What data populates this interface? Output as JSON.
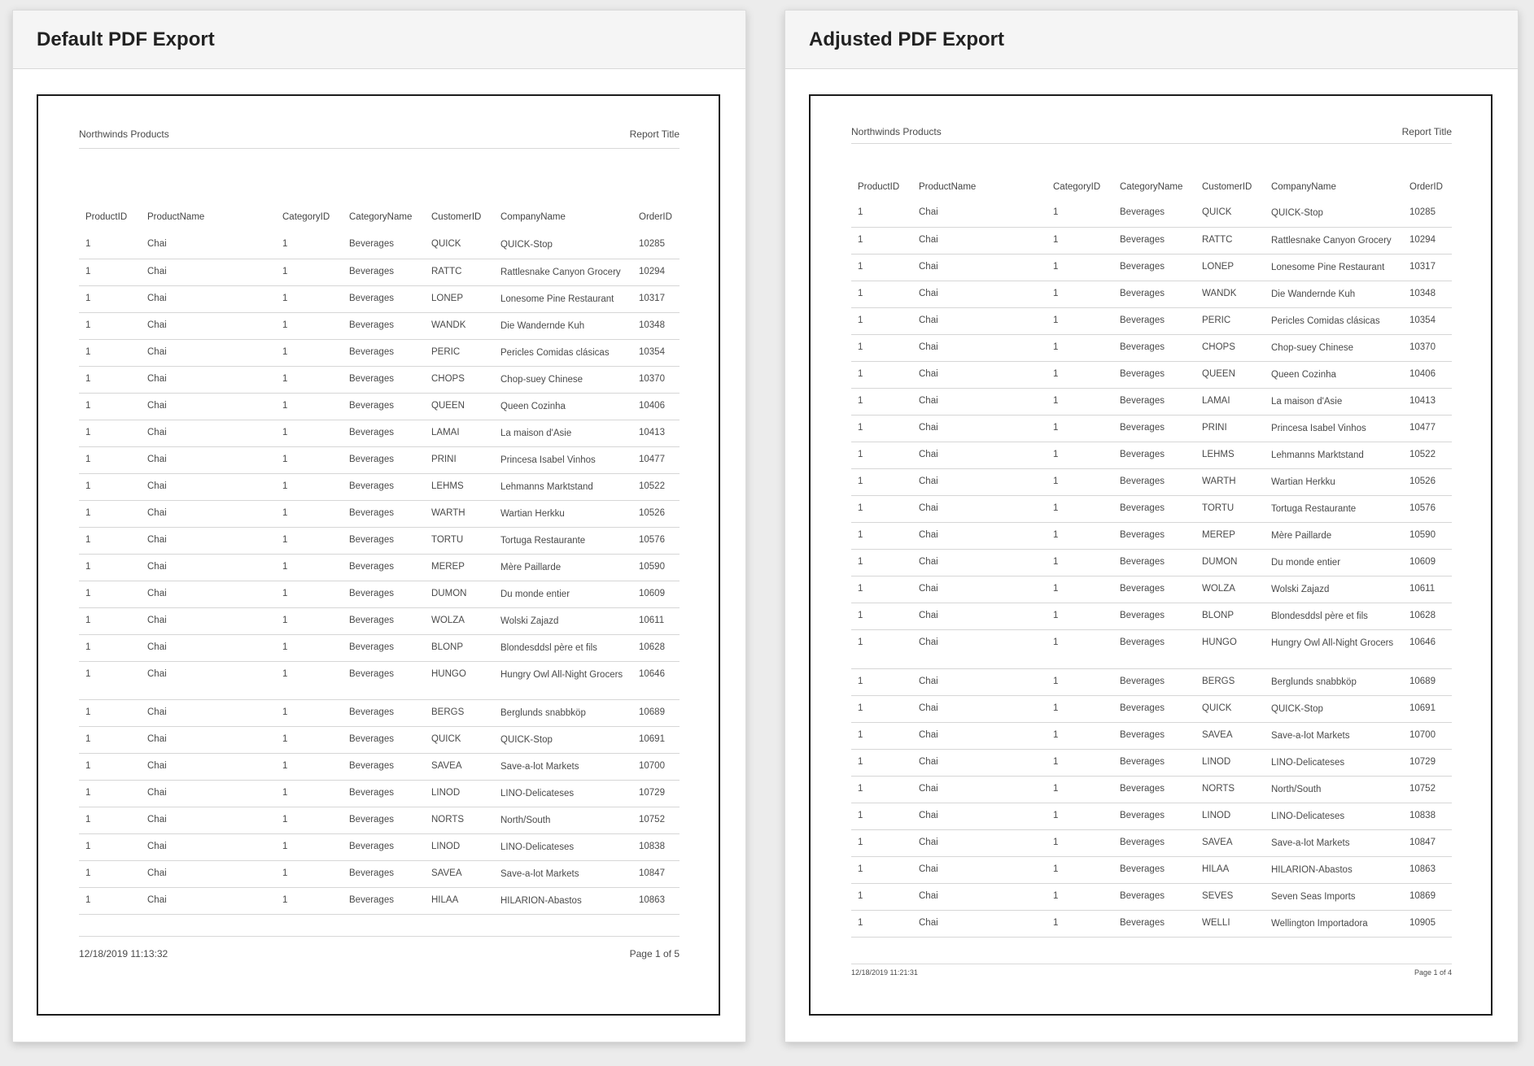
{
  "panels": [
    {
      "title": "Default PDF Export",
      "doc": {
        "left_header": "Northwinds Products",
        "right_header": "Report Title",
        "columns": [
          "ProductID",
          "ProductName",
          "CategoryID",
          "CategoryName",
          "CustomerID",
          "CompanyName",
          "OrderID"
        ],
        "rows": [
          [
            "1",
            "Chai",
            "1",
            "Beverages",
            "QUICK",
            "QUICK-Stop",
            "10285"
          ],
          [
            "1",
            "Chai",
            "1",
            "Beverages",
            "RATTC",
            "Rattlesnake Canyon Grocery",
            "10294"
          ],
          [
            "1",
            "Chai",
            "1",
            "Beverages",
            "LONEP",
            "Lonesome Pine Restaurant",
            "10317"
          ],
          [
            "1",
            "Chai",
            "1",
            "Beverages",
            "WANDK",
            "Die Wandernde Kuh",
            "10348"
          ],
          [
            "1",
            "Chai",
            "1",
            "Beverages",
            "PERIC",
            "Pericles Comidas clásicas",
            "10354"
          ],
          [
            "1",
            "Chai",
            "1",
            "Beverages",
            "CHOPS",
            "Chop-suey Chinese",
            "10370"
          ],
          [
            "1",
            "Chai",
            "1",
            "Beverages",
            "QUEEN",
            "Queen Cozinha",
            "10406"
          ],
          [
            "1",
            "Chai",
            "1",
            "Beverages",
            "LAMAI",
            "La maison d'Asie",
            "10413"
          ],
          [
            "1",
            "Chai",
            "1",
            "Beverages",
            "PRINI",
            "Princesa Isabel Vinhos",
            "10477"
          ],
          [
            "1",
            "Chai",
            "1",
            "Beverages",
            "LEHMS",
            "Lehmanns Marktstand",
            "10522"
          ],
          [
            "1",
            "Chai",
            "1",
            "Beverages",
            "WARTH",
            "Wartian Herkku",
            "10526"
          ],
          [
            "1",
            "Chai",
            "1",
            "Beverages",
            "TORTU",
            "Tortuga Restaurante",
            "10576"
          ],
          [
            "1",
            "Chai",
            "1",
            "Beverages",
            "MEREP",
            "Mère Paillarde",
            "10590"
          ],
          [
            "1",
            "Chai",
            "1",
            "Beverages",
            "DUMON",
            "Du monde entier",
            "10609"
          ],
          [
            "1",
            "Chai",
            "1",
            "Beverages",
            "WOLZA",
            "Wolski Zajazd",
            "10611"
          ],
          [
            "1",
            "Chai",
            "1",
            "Beverages",
            "BLONP",
            "Blondesddsl père et fils",
            "10628"
          ],
          [
            "1",
            "Chai",
            "1",
            "Beverages",
            "HUNGO",
            "Hungry Owl All-Night Grocers",
            "10646"
          ],
          [
            "1",
            "Chai",
            "1",
            "Beverages",
            "BERGS",
            "Berglunds snabbköp",
            "10689"
          ],
          [
            "1",
            "Chai",
            "1",
            "Beverages",
            "QUICK",
            "QUICK-Stop",
            "10691"
          ],
          [
            "1",
            "Chai",
            "1",
            "Beverages",
            "SAVEA",
            "Save-a-lot Markets",
            "10700"
          ],
          [
            "1",
            "Chai",
            "1",
            "Beverages",
            "LINOD",
            "LINO-Delicateses",
            "10729"
          ],
          [
            "1",
            "Chai",
            "1",
            "Beverages",
            "NORTS",
            "North/South",
            "10752"
          ],
          [
            "1",
            "Chai",
            "1",
            "Beverages",
            "LINOD",
            "LINO-Delicateses",
            "10838"
          ],
          [
            "1",
            "Chai",
            "1",
            "Beverages",
            "SAVEA",
            "Save-a-lot Markets",
            "10847"
          ],
          [
            "1",
            "Chai",
            "1",
            "Beverages",
            "HILAA",
            "HILARION-Abastos",
            "10863"
          ]
        ],
        "footer_left": "12/18/2019 11:13:32",
        "footer_right": "Page 1 of 5"
      }
    },
    {
      "title": "Adjusted PDF Export",
      "doc": {
        "left_header": "Northwinds Products",
        "right_header": "Report Title",
        "columns": [
          "ProductID",
          "ProductName",
          "CategoryID",
          "CategoryName",
          "CustomerID",
          "CompanyName",
          "OrderID"
        ],
        "rows": [
          [
            "1",
            "Chai",
            "1",
            "Beverages",
            "QUICK",
            "QUICK-Stop",
            "10285"
          ],
          [
            "1",
            "Chai",
            "1",
            "Beverages",
            "RATTC",
            "Rattlesnake Canyon Grocery",
            "10294"
          ],
          [
            "1",
            "Chai",
            "1",
            "Beverages",
            "LONEP",
            "Lonesome Pine Restaurant",
            "10317"
          ],
          [
            "1",
            "Chai",
            "1",
            "Beverages",
            "WANDK",
            "Die Wandernde Kuh",
            "10348"
          ],
          [
            "1",
            "Chai",
            "1",
            "Beverages",
            "PERIC",
            "Pericles Comidas clásicas",
            "10354"
          ],
          [
            "1",
            "Chai",
            "1",
            "Beverages",
            "CHOPS",
            "Chop-suey Chinese",
            "10370"
          ],
          [
            "1",
            "Chai",
            "1",
            "Beverages",
            "QUEEN",
            "Queen Cozinha",
            "10406"
          ],
          [
            "1",
            "Chai",
            "1",
            "Beverages",
            "LAMAI",
            "La maison d'Asie",
            "10413"
          ],
          [
            "1",
            "Chai",
            "1",
            "Beverages",
            "PRINI",
            "Princesa Isabel Vinhos",
            "10477"
          ],
          [
            "1",
            "Chai",
            "1",
            "Beverages",
            "LEHMS",
            "Lehmanns Marktstand",
            "10522"
          ],
          [
            "1",
            "Chai",
            "1",
            "Beverages",
            "WARTH",
            "Wartian Herkku",
            "10526"
          ],
          [
            "1",
            "Chai",
            "1",
            "Beverages",
            "TORTU",
            "Tortuga Restaurante",
            "10576"
          ],
          [
            "1",
            "Chai",
            "1",
            "Beverages",
            "MEREP",
            "Mère Paillarde",
            "10590"
          ],
          [
            "1",
            "Chai",
            "1",
            "Beverages",
            "DUMON",
            "Du monde entier",
            "10609"
          ],
          [
            "1",
            "Chai",
            "1",
            "Beverages",
            "WOLZA",
            "Wolski Zajazd",
            "10611"
          ],
          [
            "1",
            "Chai",
            "1",
            "Beverages",
            "BLONP",
            "Blondesddsl père et fils",
            "10628"
          ],
          [
            "1",
            "Chai",
            "1",
            "Beverages",
            "HUNGO",
            "Hungry Owl All-Night Grocers",
            "10646"
          ],
          [
            "1",
            "Chai",
            "1",
            "Beverages",
            "BERGS",
            "Berglunds snabbköp",
            "10689"
          ],
          [
            "1",
            "Chai",
            "1",
            "Beverages",
            "QUICK",
            "QUICK-Stop",
            "10691"
          ],
          [
            "1",
            "Chai",
            "1",
            "Beverages",
            "SAVEA",
            "Save-a-lot Markets",
            "10700"
          ],
          [
            "1",
            "Chai",
            "1",
            "Beverages",
            "LINOD",
            "LINO-Delicateses",
            "10729"
          ],
          [
            "1",
            "Chai",
            "1",
            "Beverages",
            "NORTS",
            "North/South",
            "10752"
          ],
          [
            "1",
            "Chai",
            "1",
            "Beverages",
            "LINOD",
            "LINO-Delicateses",
            "10838"
          ],
          [
            "1",
            "Chai",
            "1",
            "Beverages",
            "SAVEA",
            "Save-a-lot Markets",
            "10847"
          ],
          [
            "1",
            "Chai",
            "1",
            "Beverages",
            "HILAA",
            "HILARION-Abastos",
            "10863"
          ],
          [
            "1",
            "Chai",
            "1",
            "Beverages",
            "SEVES",
            "Seven Seas Imports",
            "10869"
          ],
          [
            "1",
            "Chai",
            "1",
            "Beverages",
            "WELLI",
            "Wellington Importadora",
            "10905"
          ]
        ],
        "footer_left": "12/18/2019 11:21:31",
        "footer_right": "Page 1 of 4"
      }
    }
  ]
}
